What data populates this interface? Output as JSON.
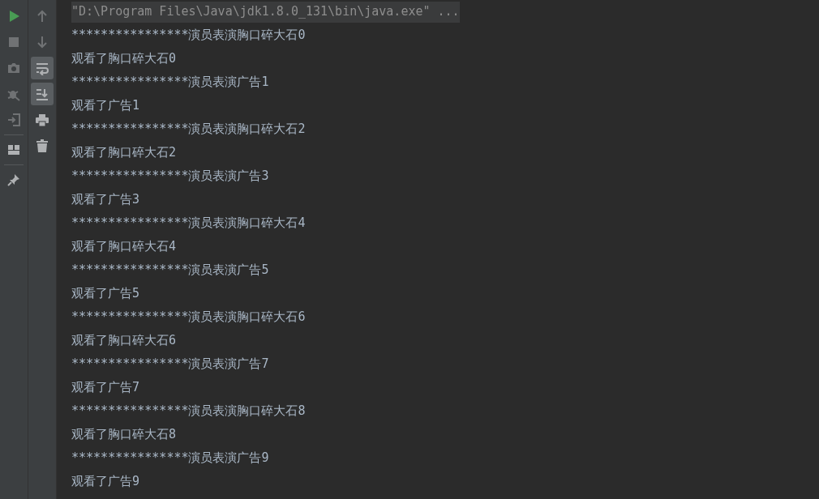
{
  "left_toolbar": [
    {
      "kind": "run",
      "disabled": false
    },
    {
      "kind": "stop",
      "disabled": true
    },
    {
      "kind": "camera",
      "disabled": true
    },
    {
      "kind": "debug",
      "disabled": true
    },
    {
      "kind": "exit",
      "disabled": true
    },
    {
      "kind": "separator"
    },
    {
      "kind": "layout",
      "disabled": false
    },
    {
      "kind": "separator"
    },
    {
      "kind": "pin",
      "disabled": false
    }
  ],
  "right_toolbar": [
    {
      "kind": "up",
      "on": false,
      "disabled": true
    },
    {
      "kind": "down",
      "on": false,
      "disabled": true
    },
    {
      "kind": "wrap",
      "on": true,
      "disabled": false
    },
    {
      "kind": "scroll-end",
      "on": true,
      "disabled": false
    },
    {
      "kind": "print",
      "on": false,
      "disabled": false
    },
    {
      "kind": "trash",
      "on": false,
      "disabled": false
    }
  ],
  "console": {
    "command": "\"D:\\Program Files\\Java\\jdk1.8.0_131\\bin\\java.exe\" ...",
    "lines": [
      "****************演员表演胸口碎大石0",
      "观看了胸口碎大石0",
      "****************演员表演广告1",
      "观看了广告1",
      "****************演员表演胸口碎大石2",
      "观看了胸口碎大石2",
      "****************演员表演广告3",
      "观看了广告3",
      "****************演员表演胸口碎大石4",
      "观看了胸口碎大石4",
      "****************演员表演广告5",
      "观看了广告5",
      "****************演员表演胸口碎大石6",
      "观看了胸口碎大石6",
      "****************演员表演广告7",
      "观看了广告7",
      "****************演员表演胸口碎大石8",
      "观看了胸口碎大石8",
      "****************演员表演广告9",
      "观看了广告9"
    ]
  }
}
